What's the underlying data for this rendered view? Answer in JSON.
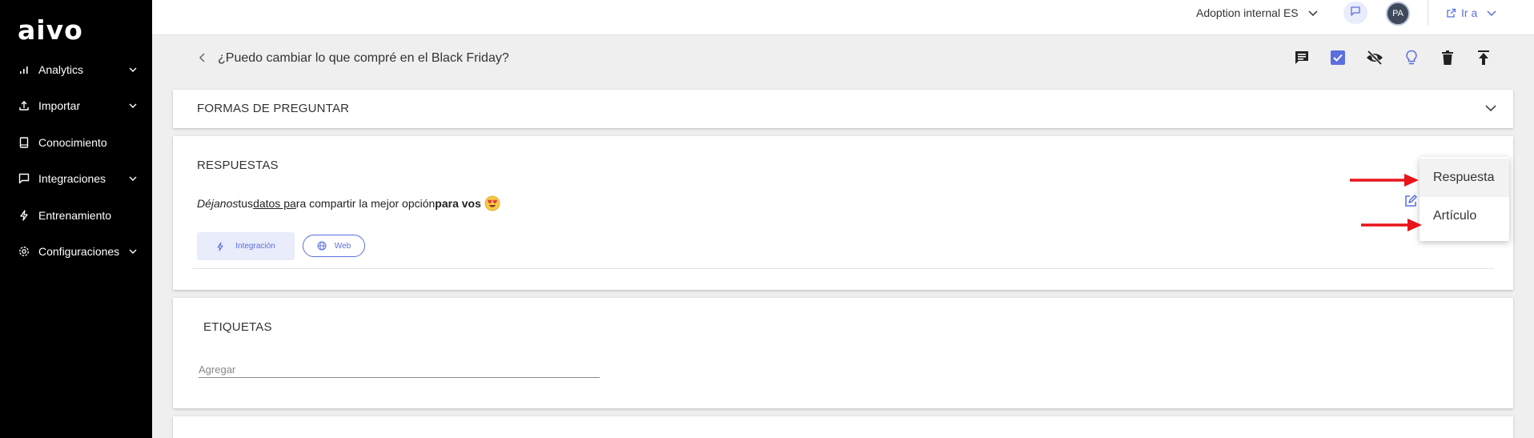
{
  "sidebar": {
    "logo": "aivo",
    "items": [
      {
        "label": "Analytics",
        "icon": "bar-chart-icon",
        "has_chevron": true
      },
      {
        "label": "Importar",
        "icon": "upload-icon",
        "has_chevron": true
      },
      {
        "label": "Conocimiento",
        "icon": "book-icon",
        "has_chevron": false
      },
      {
        "label": "Integraciones",
        "icon": "message-square-icon",
        "has_chevron": true
      },
      {
        "label": "Entrenamiento",
        "icon": "lightning-icon",
        "has_chevron": false
      },
      {
        "label": "Configuraciones",
        "icon": "settings-icon",
        "has_chevron": true
      }
    ]
  },
  "topbar": {
    "workspace": "Adoption internal ES",
    "avatar_initials": "PA",
    "goto_label": "Ir a"
  },
  "question": {
    "title": "¿Puedo cambiar lo que compré en el Black Friday?",
    "actions": [
      "comment-icon",
      "checkbox-checked-icon",
      "eye-off-icon",
      "lightbulb-icon",
      "trash-icon",
      "publish-icon"
    ]
  },
  "formas": {
    "title": "FORMAS DE PREGUNTAR"
  },
  "respuestas": {
    "title": "RESPUESTAS",
    "text_part1": "Déjanos",
    "text_part2": " tus ",
    "text_part3": "datos pa",
    "text_part4": "ra compartir la mejor opción ",
    "text_part5": "para vos",
    "chip_integration": "Integración",
    "chip_web": "Web"
  },
  "etiquetas": {
    "title": "ETIQUETAS",
    "placeholder": "Agregar"
  },
  "menu": {
    "items": [
      "Respuesta",
      "Artículo"
    ]
  },
  "colors": {
    "accent": "#5b6fe0",
    "annotation_arrow": "#e8141c",
    "sidebar_bg": "#000000"
  }
}
